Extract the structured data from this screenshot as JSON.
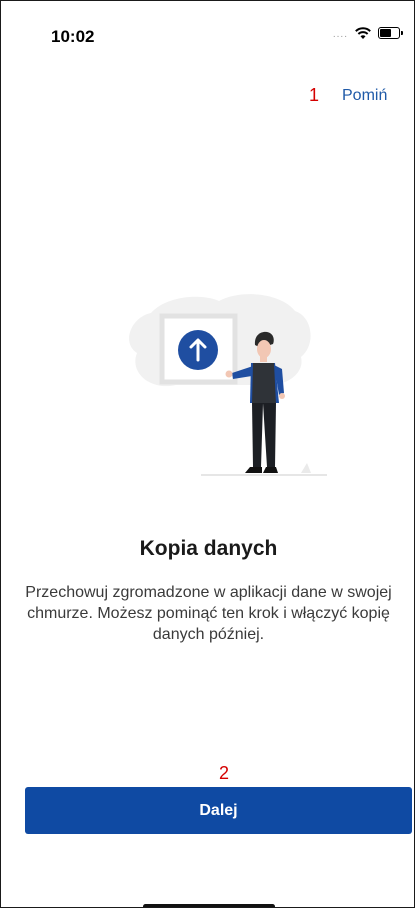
{
  "status_bar": {
    "time": "10:02",
    "signal": "....",
    "wifi_icon": "wifi-icon",
    "battery_icon": "battery-icon"
  },
  "annotations": {
    "marker_1": "1",
    "marker_2": "2"
  },
  "header": {
    "skip_label": "Pomiń"
  },
  "illustration": {
    "icon": "upload-arrow-icon",
    "accent_color": "#1f4ea1"
  },
  "content": {
    "title": "Kopia danych",
    "description": "Przechowuj zgromadzone w aplikacji dane w swojej chmurze. Możesz pominąć ten krok i włączyć kopię danych później."
  },
  "footer": {
    "next_label": "Dalej",
    "button_color": "#0f4aa3"
  }
}
